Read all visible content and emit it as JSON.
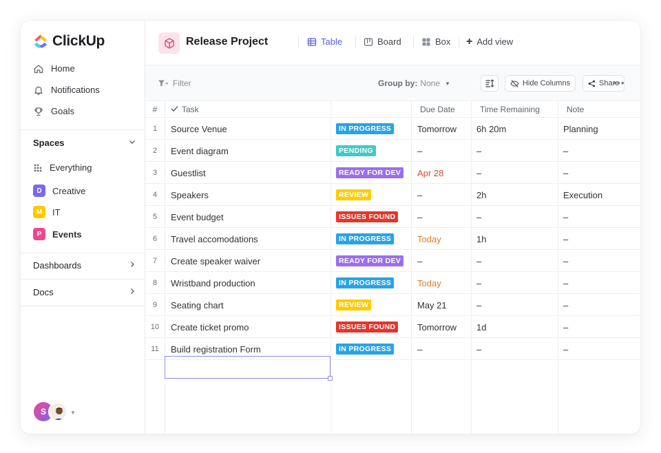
{
  "app": {
    "name": "ClickUp"
  },
  "sidebar": {
    "nav": [
      {
        "label": "Home",
        "icon": "home-icon"
      },
      {
        "label": "Notifications",
        "icon": "bell-icon"
      },
      {
        "label": "Goals",
        "icon": "trophy-icon"
      }
    ],
    "spaces_label": "Spaces",
    "spaces": [
      {
        "label": "Everything",
        "badge": "",
        "color": ""
      },
      {
        "label": "Creative",
        "badge": "D",
        "color": "#7b68ee"
      },
      {
        "label": "IT",
        "badge": "M",
        "color": "#ffc800"
      },
      {
        "label": "Events",
        "badge": "P",
        "color": "#f0468e"
      }
    ],
    "dashboards_label": "Dashboards",
    "docs_label": "Docs",
    "user_initial": "S"
  },
  "header": {
    "title": "Release Project",
    "views": [
      {
        "label": "Table",
        "icon": "table-icon",
        "active": true
      },
      {
        "label": "Board",
        "icon": "board-icon",
        "active": false
      },
      {
        "label": "Box",
        "icon": "box-icon",
        "active": false
      }
    ],
    "add_view_label": "Add view"
  },
  "toolbar": {
    "filter_label": "Filter",
    "group_by_label": "Group by:",
    "group_by_value": "None",
    "hide_columns_label": "Hide Columns",
    "share_label": "Share",
    "more_label": "•••"
  },
  "table": {
    "columns": {
      "num": "#",
      "task": "Task",
      "status": "",
      "due": "Due Date",
      "time": "Time Remaining",
      "note": "Note"
    },
    "status_colors": {
      "IN PROGRESS": "#28a3e6",
      "PENDING": "#40c8c8",
      "READY FOR DEV": "#9b6ef0",
      "REVIEW": "#ffcc00",
      "ISSUES FOUND": "#e5352b"
    },
    "due_colors": {
      "red": "#d9482c",
      "orange": "#d67f2a"
    },
    "rows": [
      {
        "num": "1",
        "task": "Source Venue",
        "status": "IN PROGRESS",
        "due": "Tomorrow",
        "due_color": "",
        "time": "6h 20m",
        "note": "Planning"
      },
      {
        "num": "2",
        "task": "Event diagram",
        "status": "PENDING",
        "due": "–",
        "due_color": "",
        "time": "–",
        "note": "–"
      },
      {
        "num": "3",
        "task": "Guestlist",
        "status": "READY FOR DEV",
        "due": "Apr 28",
        "due_color": "red",
        "time": "–",
        "note": "–"
      },
      {
        "num": "4",
        "task": "Speakers",
        "status": "REVIEW",
        "due": "–",
        "due_color": "",
        "time": "2h",
        "note": "Execution"
      },
      {
        "num": "5",
        "task": "Event budget",
        "status": "ISSUES FOUND",
        "due": "–",
        "due_color": "",
        "time": "–",
        "note": "–"
      },
      {
        "num": "6",
        "task": "Travel accomodations",
        "status": "IN PROGRESS",
        "due": "Today",
        "due_color": "orange",
        "time": "1h",
        "note": "–"
      },
      {
        "num": "7",
        "task": "Create speaker waiver",
        "status": "READY FOR DEV",
        "due": "–",
        "due_color": "",
        "time": "–",
        "note": "–"
      },
      {
        "num": "8",
        "task": "Wristband production",
        "status": "IN PROGRESS",
        "due": "Today",
        "due_color": "orange",
        "time": "–",
        "note": "–"
      },
      {
        "num": "9",
        "task": "Seating chart",
        "status": "REVIEW",
        "due": "May 21",
        "due_color": "",
        "time": "–",
        "note": "–"
      },
      {
        "num": "10",
        "task": "Create ticket promo",
        "status": "ISSUES FOUND",
        "due": "Tomorrow",
        "due_color": "",
        "time": "1d",
        "note": "–"
      },
      {
        "num": "11",
        "task": "Build registration Form",
        "status": "IN PROGRESS",
        "due": "–",
        "due_color": "",
        "time": "–",
        "note": "–"
      }
    ]
  }
}
